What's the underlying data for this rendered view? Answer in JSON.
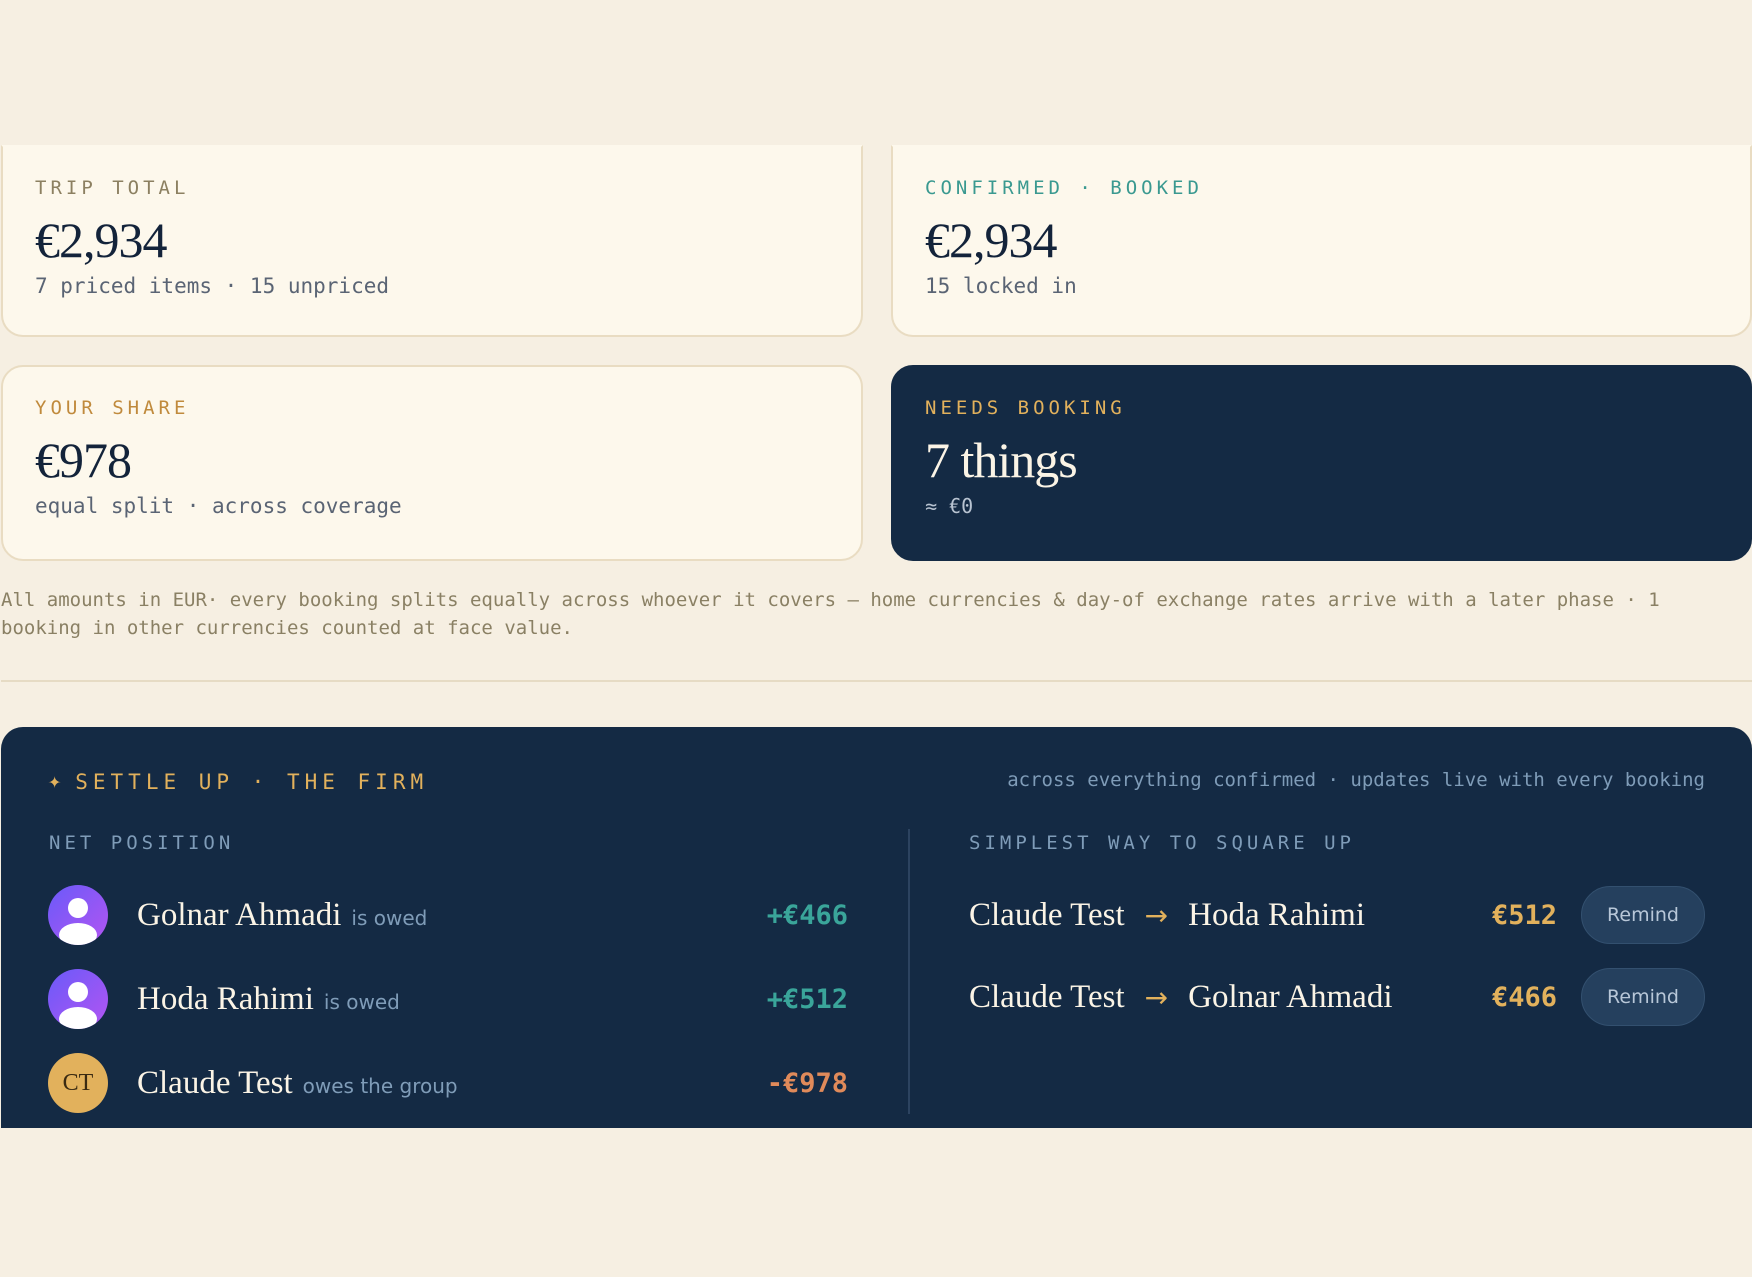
{
  "summary": {
    "trip_total": {
      "label": "TRIP TOTAL",
      "value": "€2,934",
      "sub": "7 priced items · 15 unpriced"
    },
    "confirmed": {
      "label": "CONFIRMED · BOOKED",
      "value": "€2,934",
      "sub": "15 locked in"
    },
    "your_share": {
      "label": "YOUR SHARE",
      "value": "€978",
      "sub": "equal split · across coverage"
    },
    "needs_booking": {
      "label": "NEEDS BOOKING",
      "value": "7 things",
      "sub": "≈ €0"
    }
  },
  "note": "All amounts in EUR· every booking splits equally across whoever it covers — home currencies & day-of exchange rates arrive with a later phase · 1 booking in other currencies counted at face value.",
  "settle": {
    "title": "SETTLE UP · THE FIRM",
    "tagline": "across everything confirmed · updates live with every booking",
    "net_label": "NET POSITION",
    "square_label": "SIMPLEST WAY TO SQUARE UP",
    "people": [
      {
        "name": "Golnar Ahmadi",
        "status": "is owed",
        "amount": "+€466",
        "avatar": "user-icon"
      },
      {
        "name": "Hoda Rahimi",
        "status": "is owed",
        "amount": "+€512",
        "avatar": "user-icon"
      },
      {
        "name": "Claude Test",
        "status": "owes the group",
        "amount": "-€978",
        "initials": "CT"
      }
    ],
    "transfers": [
      {
        "from": "Claude Test",
        "to": "Hoda Rahimi",
        "amount": "€512",
        "action": "Remind"
      },
      {
        "from": "Claude Test",
        "to": "Golnar Ahmadi",
        "amount": "€466",
        "action": "Remind"
      }
    ],
    "arrow_glyph": "→",
    "star_glyph": "✦"
  },
  "colors": {
    "navy": "#142a44",
    "cream": "#fdf8ec",
    "gold": "#e2b15c",
    "teal": "#3aa59a",
    "coral": "#e08a5a"
  }
}
